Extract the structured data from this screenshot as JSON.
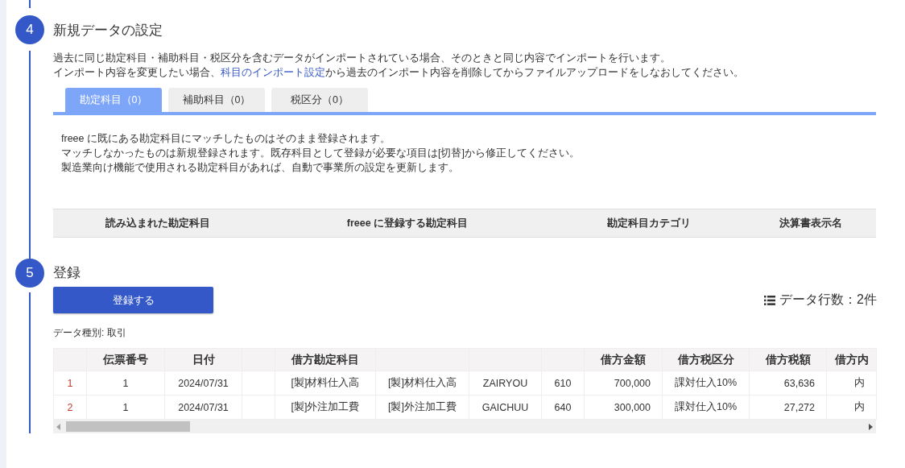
{
  "steps": [
    {
      "number": "4",
      "title": "新規データの設定",
      "description": [
        {
          "text": "過去に同じ勘定科目・補助科目・税区分を含むデータがインポートされている場合、そのときと同じ内容でインポートを行います。"
        },
        {
          "text": "インポート内容を変更したい場合、",
          "link": "科目のインポート設定",
          "after": "から過去のインポート内容を削除してからファイルアップロードをしなおしてください。"
        }
      ],
      "tabs": [
        {
          "label": "勘定科目（0）",
          "selected": true
        },
        {
          "label": "補助科目（0）",
          "selected": false
        },
        {
          "label": "税区分（0）",
          "selected": false
        }
      ],
      "tab_notes": [
        "freee に既にある勘定科目にマッチしたものはそのまま登録されます。",
        "マッチしなかったものは新規登録されます。既存科目として登録が必要な項目は[切替]から修正してください。",
        "製造業向け機能で使用される勘定科目があれば、自動で事業所の設定を更新します。"
      ],
      "mapping_table": {
        "columns": [
          "読み込まれた勘定科目",
          "freee に登録する勘定科目",
          "勘定科目カテゴリ",
          "決算書表示名"
        ]
      }
    }
  ],
  "register": {
    "number": "5",
    "title": "登録",
    "button": "登録する",
    "row_count": "データ行数：2件",
    "data_type": "データ種別: 取引",
    "table": {
      "headers": {
        "column_2": "伝票番号",
        "column_3": "日付",
        "column_5": "借方勘定科目",
        "column_9": "借方金額",
        "column_10": "借方税区分",
        "column_11": "借方税額",
        "column_12": "借方内"
      },
      "rows": [
        {
          "column_1": "1",
          "column_2": "1",
          "column_3": "2024/07/31",
          "column_5": "[製]材料仕入高",
          "column_6": "[製]材料仕入高",
          "column_7": "ZAIRYOU",
          "column_8": "610",
          "column_9": "700,000",
          "column_10": "課対仕入10%",
          "column_11": "63,636",
          "column_12": "内"
        },
        {
          "column_1": "2",
          "column_2": "1",
          "column_3": "2024/07/31",
          "column_5": "[製]外注加工費",
          "column_6": "[製]外注加工費",
          "column_7": "GAICHUU",
          "column_8": "640",
          "column_9": "300,000",
          "column_10": "課対仕入10%",
          "column_11": "27,272",
          "column_12": "内"
        }
      ]
    }
  }
}
